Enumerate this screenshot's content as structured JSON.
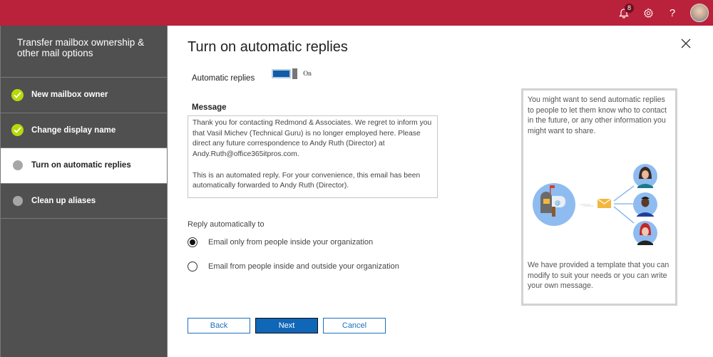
{
  "topbar": {
    "notifications_count": "8",
    "icons": [
      "bell-icon",
      "gear-icon",
      "help-icon",
      "avatar"
    ],
    "help_glyph": "?",
    "brand_color": "#ba213a"
  },
  "sidebar": {
    "title": "Transfer mailbox ownership & other mail options",
    "items": [
      {
        "label": "New mailbox owner",
        "status": "done"
      },
      {
        "label": "Change display name",
        "status": "done"
      },
      {
        "label": "Turn on automatic replies",
        "status": "current"
      },
      {
        "label": "Clean up aliases",
        "status": "pending"
      }
    ]
  },
  "main": {
    "title": "Turn on automatic replies",
    "auto_replies": {
      "label": "Automatic replies",
      "state_label": "On",
      "enabled": true
    },
    "message": {
      "label": "Message",
      "value": "Thank you for contacting Redmond & Associates. We regret to inform you that Vasil Michev (Technical Guru) is no longer employed here. Please direct any future correspondence to Andy Ruth (Director) at Andy.Ruth@office365itpros.com.\n\nThis is an automated reply. For your convenience, this email has been automatically forwarded to Andy Ruth (Director)."
    },
    "reply_to": {
      "label": "Reply automatically to",
      "options": [
        {
          "label": "Email only from people inside your organization",
          "selected": true
        },
        {
          "label": "Email from people inside and outside your organization",
          "selected": false
        }
      ]
    },
    "buttons": {
      "back": "Back",
      "next": "Next",
      "cancel": "Cancel"
    },
    "accent_color": "#1066b7"
  },
  "info_panel": {
    "text_top": "You might want to send automatic replies to people to let them know who to contact in the future, or any other information you might want to share.",
    "text_bottom": "We have provided a template that you can modify to suit your needs or you can write your own message."
  }
}
